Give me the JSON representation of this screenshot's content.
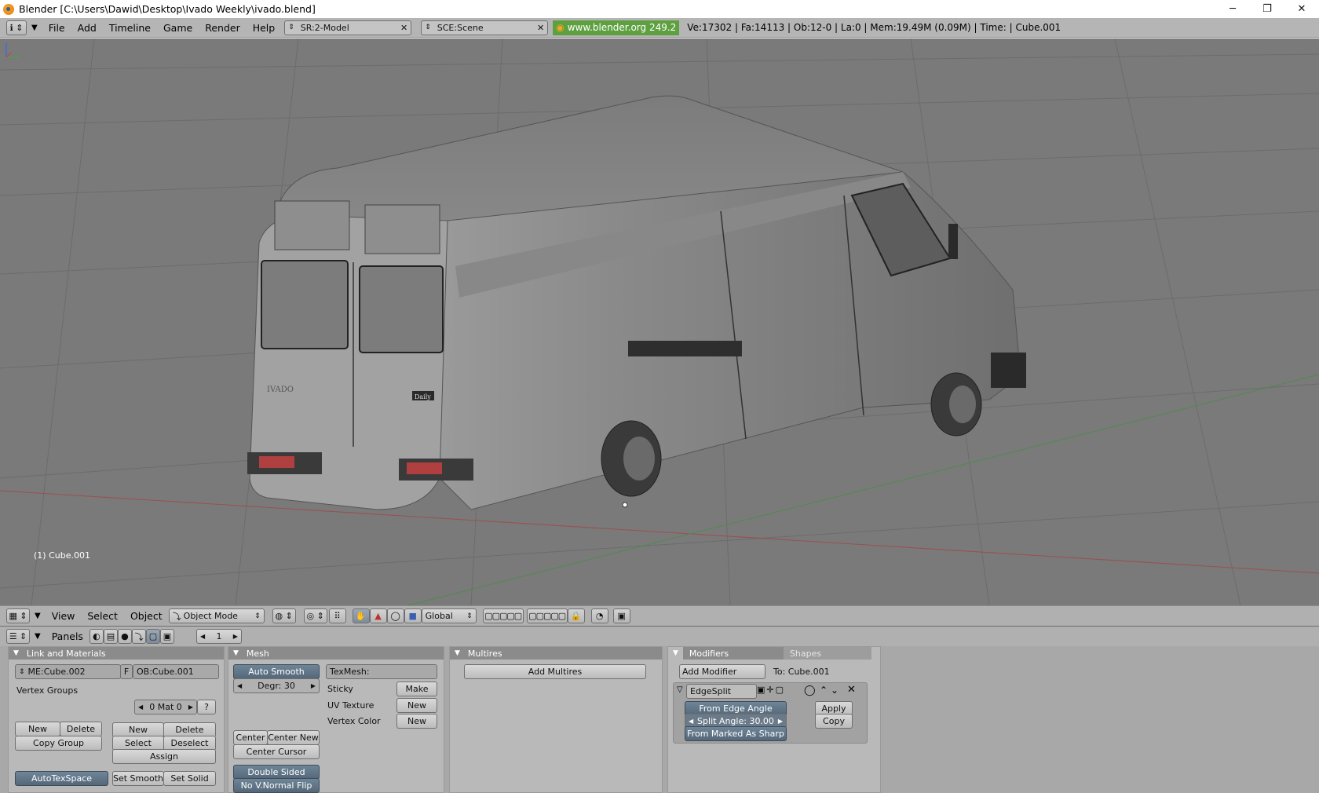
{
  "window": {
    "title": "Blender [C:\\Users\\Dawid\\Desktop\\Ivado Weekly\\ivado.blend]",
    "minimize": "─",
    "maximize": "❐",
    "close": "✕"
  },
  "infobar": {
    "menus": [
      "File",
      "Add",
      "Timeline",
      "Game",
      "Render",
      "Help"
    ],
    "screen": "SR:2-Model",
    "scene": "SCE:Scene",
    "website": "www.blender.org 249.2",
    "stats": "Ve:17302 | Fa:14113 | Ob:12-0 | La:0  | Mem:19.49M (0.09M)  | Time: | Cube.001"
  },
  "viewport": {
    "object_label": "(1) Cube.001",
    "rear_badge_left": "IVADO",
    "rear_badge_right": "Daily"
  },
  "view3d_header": {
    "menus": [
      "View",
      "Select",
      "Object"
    ],
    "mode": "Object Mode",
    "orientation": "Global"
  },
  "buttons_header": {
    "panels_label": "Panels",
    "frame": "1"
  },
  "link_materials": {
    "title": "Link and Materials",
    "mesh_name": "ME:Cube.002",
    "fake_user": "F",
    "object_name": "OB:Cube.001",
    "vertex_groups": "Vertex Groups",
    "mat_count": "0 Mat 0",
    "help": "?",
    "vg_new": "New",
    "vg_delete": "Delete",
    "copy_group": "Copy Group",
    "mat_new": "New",
    "mat_delete": "Delete",
    "mat_select": "Select",
    "mat_deselect": "Deselect",
    "assign": "Assign",
    "autotexspace": "AutoTexSpace",
    "set_smooth": "Set Smooth",
    "set_solid": "Set Solid"
  },
  "mesh": {
    "title": "Mesh",
    "auto_smooth": "Auto Smooth",
    "degr": "Degr: 30",
    "texmesh": "TexMesh:",
    "sticky": "Sticky",
    "sticky_btn": "Make",
    "uv_texture": "UV Texture",
    "uv_btn": "New",
    "vertex_color": "Vertex Color",
    "vc_btn": "New",
    "center": "Center",
    "center_new": "Center New",
    "center_cursor": "Center Cursor",
    "double_sided": "Double Sided",
    "no_vnormal_flip": "No V.Normal Flip"
  },
  "multires": {
    "title": "Multires",
    "add": "Add Multires"
  },
  "modifiers": {
    "tab_modifiers": "Modifiers",
    "tab_shapes": "Shapes",
    "add": "Add Modifier",
    "to": "To: Cube.001",
    "modifier_name": "EdgeSplit",
    "from_edge_angle": "From Edge Angle",
    "split_angle": "Split Angle: 30.00",
    "from_marked_sharp": "From Marked As Sharp",
    "apply": "Apply",
    "copy": "Copy"
  }
}
